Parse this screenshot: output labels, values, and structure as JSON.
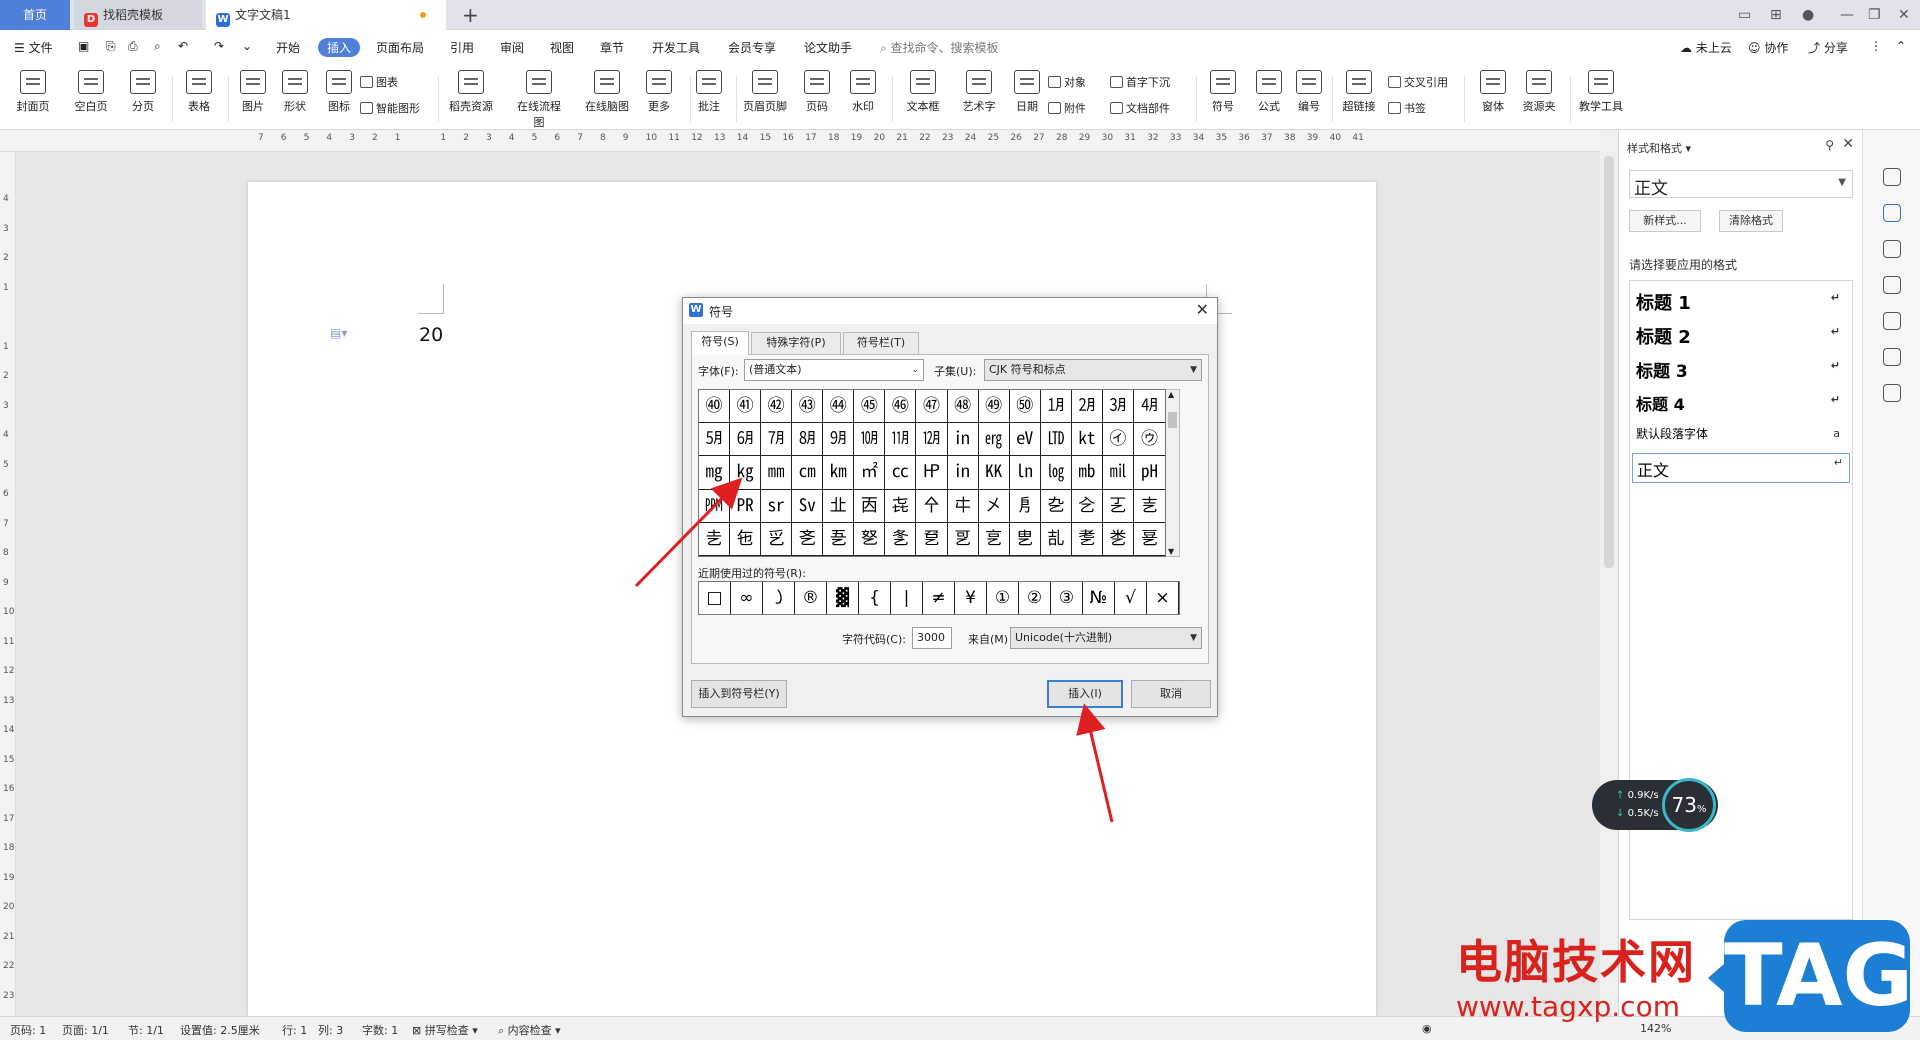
{
  "tabs": {
    "home": "首页",
    "template": "找稻壳模板",
    "document": "文字文稿1",
    "add": "+"
  },
  "menu": {
    "file": "文件",
    "items": [
      "开始",
      "插入",
      "页面布局",
      "引用",
      "审阅",
      "视图",
      "章节",
      "开发工具",
      "会员专享",
      "论文助手"
    ],
    "active": "插入",
    "search": "查找命令、搜索模板",
    "right": [
      "未上云",
      "协作",
      "分享"
    ]
  },
  "ribbon": {
    "big": [
      "封面页",
      "空白页",
      "分页",
      "表格",
      "图片",
      "形状",
      "图标",
      "稻壳资源",
      "在线流程图",
      "在线脑图",
      "更多",
      "批注",
      "页眉页脚",
      "页码",
      "水印",
      "文本框",
      "艺术字",
      "日期",
      "符号",
      "公式",
      "编号",
      "超链接",
      "窗体",
      "资源夹",
      "教学工具"
    ],
    "small": {
      "chart": "图表",
      "smart_shape": "智能图形",
      "object": "对象",
      "drop_cap": "首字下沉",
      "attachment": "附件",
      "doc_parts": "文档部件",
      "cross_ref": "交叉引用",
      "bookmark": "书签"
    }
  },
  "ruler": {
    "h": [
      "7",
      "6",
      "5",
      "4",
      "3",
      "2",
      "1",
      "",
      "1",
      "2",
      "3",
      "4",
      "5",
      "6",
      "7",
      "8",
      "9",
      "10",
      "11",
      "12",
      "13",
      "14",
      "15",
      "16",
      "17",
      "18",
      "19",
      "20",
      "21",
      "22",
      "23",
      "24",
      "25",
      "26",
      "27",
      "28",
      "29",
      "30",
      "31",
      "32",
      "33",
      "34",
      "35",
      "36",
      "37",
      "38",
      "39",
      "40",
      "41"
    ],
    "v": [
      "4",
      "3",
      "2",
      "1",
      "",
      "1",
      "2",
      "3",
      "4",
      "5",
      "6",
      "7",
      "8",
      "9",
      "10",
      "11",
      "12",
      "13",
      "14",
      "15",
      "16",
      "17",
      "18",
      "19",
      "20",
      "21",
      "22",
      "23"
    ]
  },
  "document": {
    "text": "20"
  },
  "dialog": {
    "title": "符号",
    "tabs": [
      "符号(S)",
      "特殊字符(P)",
      "符号栏(T)"
    ],
    "font_label": "字体(F):",
    "font_value": "(普通文本)",
    "subset_label": "子集(U):",
    "subset_value": "CJK 符号和标点",
    "symbols": [
      "㊵",
      "㊶",
      "㊷",
      "㊸",
      "㊹",
      "㊺",
      "㊻",
      "㊼",
      "㊽",
      "㊾",
      "㊿",
      "㋀",
      "㋁",
      "㋂",
      "㋃",
      "㋄",
      "㋅",
      "㋆",
      "㋇",
      "㋈",
      "㋉",
      "㋊",
      "㋋",
      "㏌",
      "㋍",
      "㋎",
      "㋏",
      "㏏",
      "㋑",
      "㋒",
      "㎎",
      "㎏",
      "㎜",
      "㎝",
      "㎞",
      "㎡",
      "㏄",
      "㏋",
      "㏌",
      "㏍",
      "㏑",
      "㏒",
      "㏔",
      "㏕",
      "㏗",
      "㏙",
      "㏚",
      "㏛",
      "㏜",
      "㐀",
      "㐁",
      "㐂",
      "㐃",
      "㐄",
      "㐅",
      "㐆",
      "㐇",
      "㐈",
      "㐉",
      "㐊",
      "㐋",
      "㐌",
      "㐍",
      "㐎",
      "㐏",
      "㐐",
      "㐑",
      "㐒",
      "㐓",
      "㐔",
      "㐕",
      "㐖",
      "㐗",
      "㐘",
      "㐙"
    ],
    "recent_label": "近期使用过的符号(R):",
    "recent": [
      "□",
      "∞",
      "㇁",
      "®",
      "▓",
      "{",
      "|",
      "≠",
      "¥",
      "①",
      "②",
      "③",
      "№",
      "√",
      "×"
    ],
    "code_label": "字符代码(C):",
    "code_value": "3000",
    "from_label": "来自(M)",
    "from_value": "Unicode(十六进制)",
    "insert_to_bar": "插入到符号栏(Y)",
    "insert": "插入(I)",
    "cancel": "取消"
  },
  "pane": {
    "title": "样式和格式",
    "current": "正文",
    "new_style": "新样式...",
    "clear_format": "清除格式",
    "prompt": "请选择要应用的格式",
    "styles": [
      "标题 1",
      "标题 2",
      "标题 3",
      "标题 4",
      "默认段落字体",
      "正文"
    ]
  },
  "net": {
    "up": "0.9",
    "down": "0.5",
    "unit": "K/s",
    "percent": "73",
    "percent_unit": "%"
  },
  "status": {
    "page_no": "页码: 1",
    "pages": "页面: 1/1",
    "section": "节: 1/1",
    "setting": "设置值: 2.5厘米",
    "row": "行: 1",
    "col": "列: 3",
    "words": "字数: 1",
    "spell": "拼写检查",
    "content": "内容检查",
    "zoom": "142%"
  },
  "watermark": {
    "text": "电脑技术网",
    "url": "www.tagxp.com",
    "tag": "TAG"
  },
  "colors": {
    "accent": "#4e7fd9",
    "arrow": "#e02020",
    "watermark_red": "#d9221c",
    "watermark_blue": "#1d7ed6"
  }
}
